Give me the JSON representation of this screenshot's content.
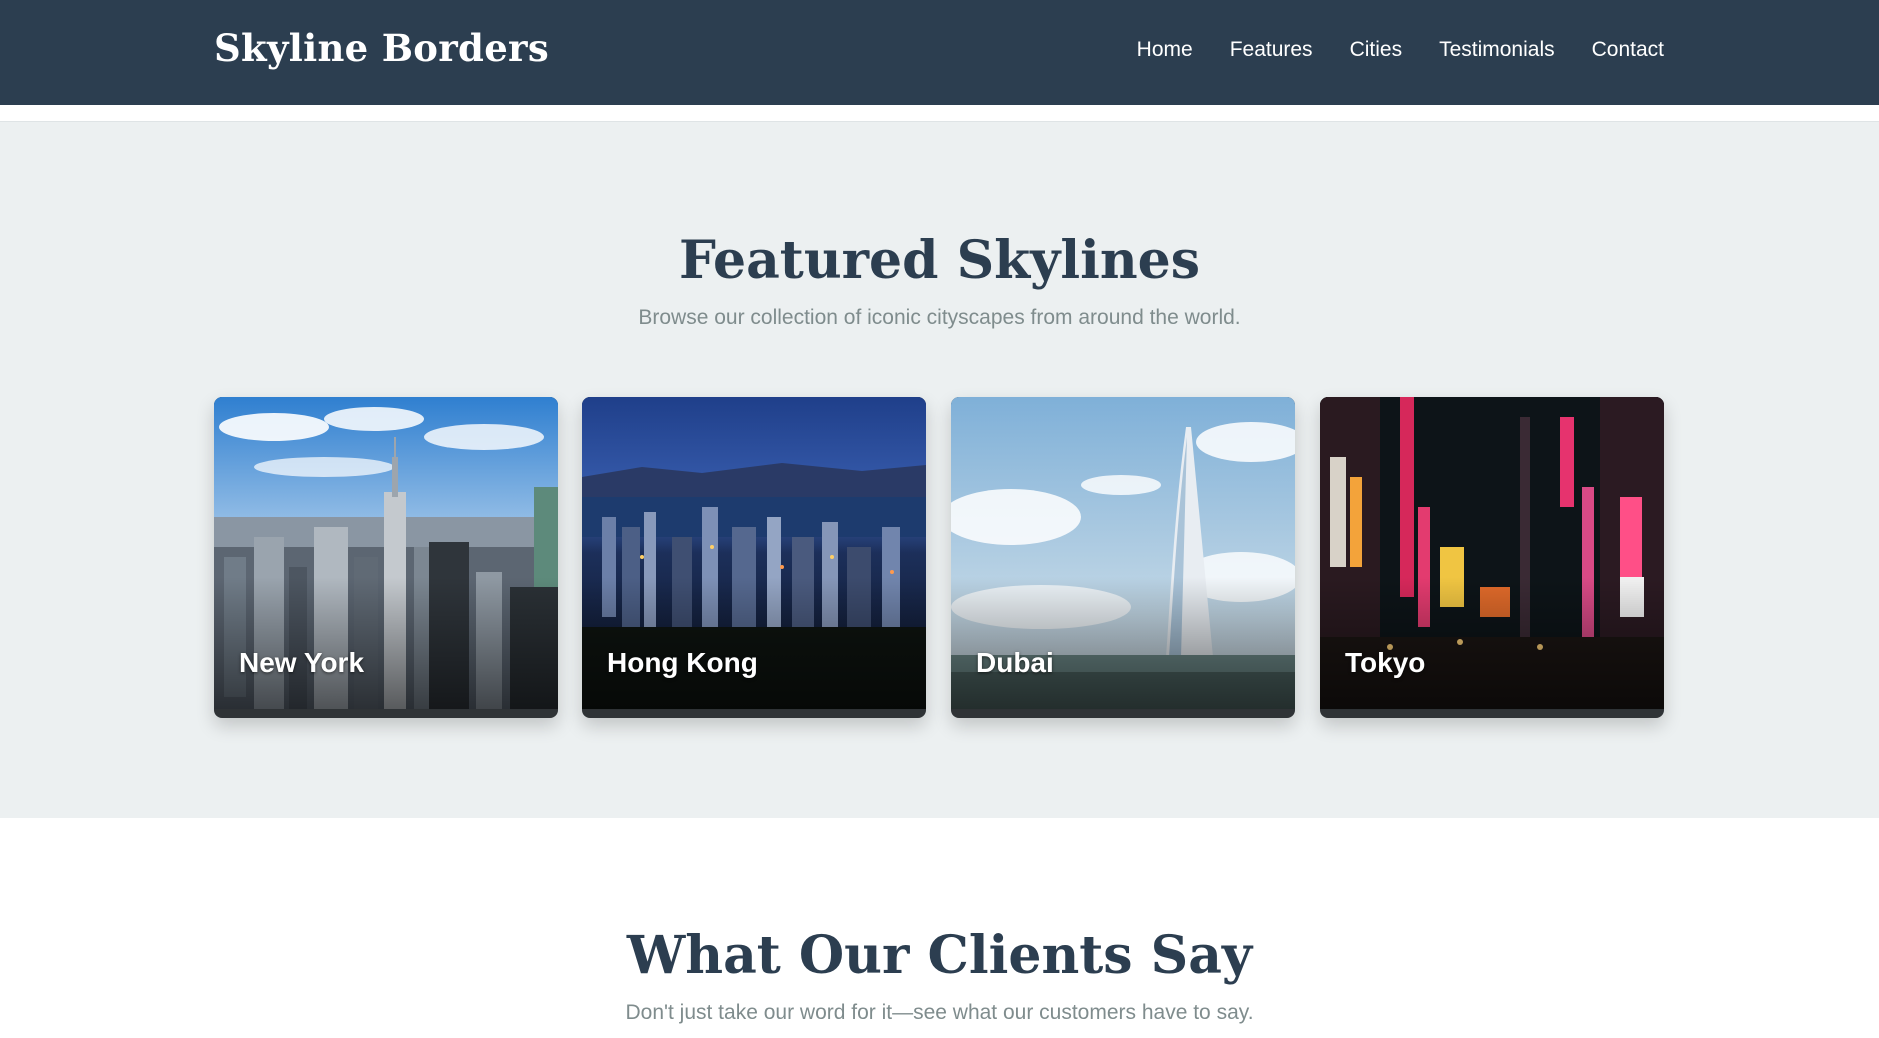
{
  "navbar": {
    "brand": "Skyline Borders",
    "links": [
      "Home",
      "Features",
      "Cities",
      "Testimonials",
      "Contact"
    ]
  },
  "featured": {
    "title": "Featured Skylines",
    "subtitle": "Browse our collection of iconic cityscapes from around the world.",
    "cities": [
      "New York",
      "Hong Kong",
      "Dubai",
      "Tokyo"
    ]
  },
  "testimonials": {
    "title": "What Our Clients Say",
    "subtitle": "Don't just take our word for it—see what our customers have to say."
  },
  "colors": {
    "navbar_bg": "#2c3e50",
    "section_bg": "#ecf0f1",
    "heading": "#2c3e50",
    "muted_text": "#7f8c8d"
  }
}
